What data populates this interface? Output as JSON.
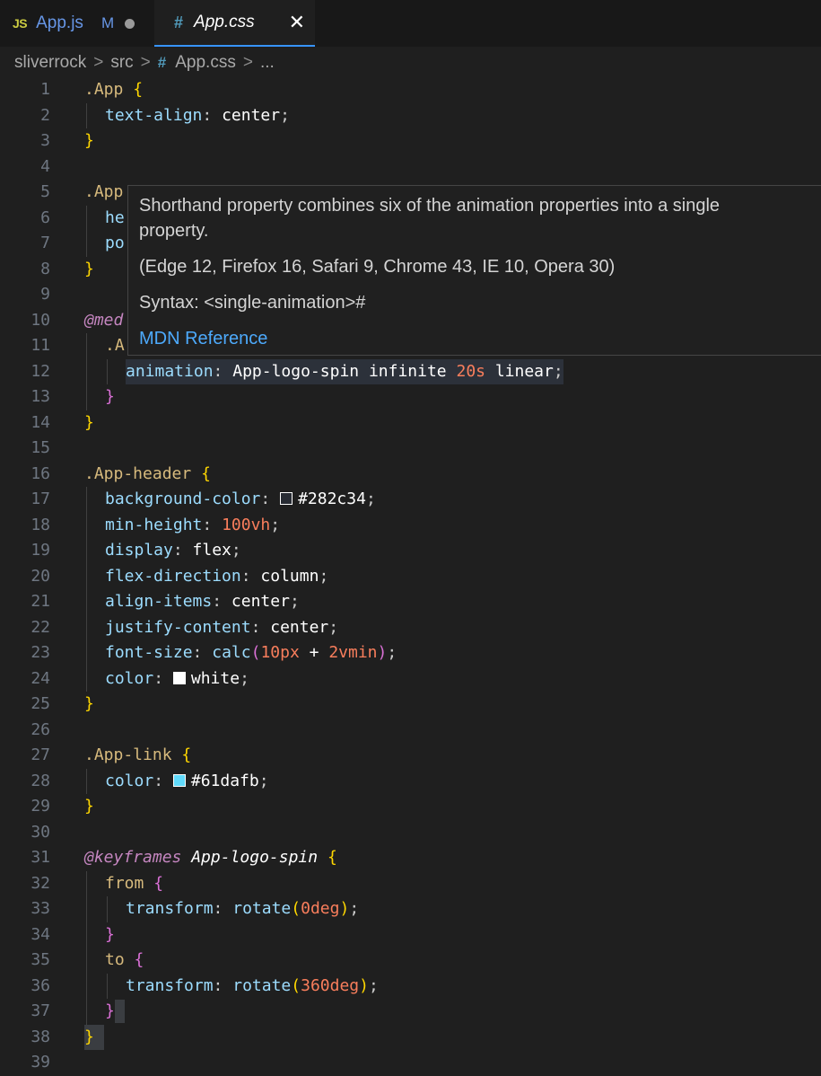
{
  "tabs": [
    {
      "icon": "JS",
      "name": "App.js",
      "status": "M",
      "dirty": true
    },
    {
      "icon": "#",
      "name": "App.css",
      "active": true,
      "close": "✕"
    }
  ],
  "breadcrumb": {
    "items": [
      "sliverrock",
      "src",
      "App.css",
      "..."
    ],
    "separator": ">"
  },
  "tooltip": {
    "description": "Shorthand property combines six of the animation properties into a single property.",
    "support": "(Edge 12, Firefox 16, Safari 9, Chrome 43, IE 10, Opera 30)",
    "syntax": "Syntax: <single-animation>#",
    "link": "MDN Reference"
  },
  "lines": [
    "1",
    "2",
    "3",
    "4",
    "5",
    "6",
    "7",
    "8",
    "9",
    "10",
    "11",
    "12",
    "13",
    "14",
    "15",
    "16",
    "17",
    "18",
    "19",
    "20",
    "21",
    "22",
    "23",
    "24",
    "25",
    "26",
    "27",
    "28",
    "29",
    "30",
    "31",
    "32",
    "33",
    "34",
    "35",
    "36",
    "37",
    "38",
    "39"
  ],
  "code": {
    "l1": ".App",
    "l2p": "text-align",
    "l2v": "center",
    "l5": ".App",
    "l6": "he",
    "l7": "po",
    "l10": "@med",
    "l11": ".A",
    "l12p": "animation",
    "l12v1": "App-logo-spin infinite ",
    "l12n": "20s",
    "l12v2": " linear",
    "l16": ".App-header",
    "l17p": "background-color",
    "l17v": "#282c34",
    "l18p": "min-height",
    "l18n": "100vh",
    "l19p": "display",
    "l19v": "flex",
    "l20p": "flex-direction",
    "l20v": "column",
    "l21p": "align-items",
    "l21v": "center",
    "l22p": "justify-content",
    "l22v": "center",
    "l23p": "font-size",
    "l23f": "calc",
    "l23n1": "10px",
    "l23o": " + ",
    "l23n2": "2vmin",
    "l24p": "color",
    "l24v": "white",
    "l27": ".App-link",
    "l28p": "color",
    "l28v": "#61dafb",
    "l31a": "@keyframes",
    "l31b": "App-logo-spin",
    "l32": "from",
    "l33p": "transform",
    "l33f": "rotate",
    "l33n": "0deg",
    "l35": "to",
    "l36p": "transform",
    "l36f": "rotate",
    "l36n": "360deg"
  },
  "colors": {
    "background": "#1f1f1f",
    "selector": "#d7ba7d",
    "property": "#9cdcfe",
    "number": "#f97e5c",
    "brace": "#ffd700",
    "brace_nested": "#da70d6"
  },
  "icons": {
    "js": "js-file-icon",
    "css": "css-hash-icon",
    "close": "close-icon",
    "dirty": "unsaved-dot-icon"
  }
}
